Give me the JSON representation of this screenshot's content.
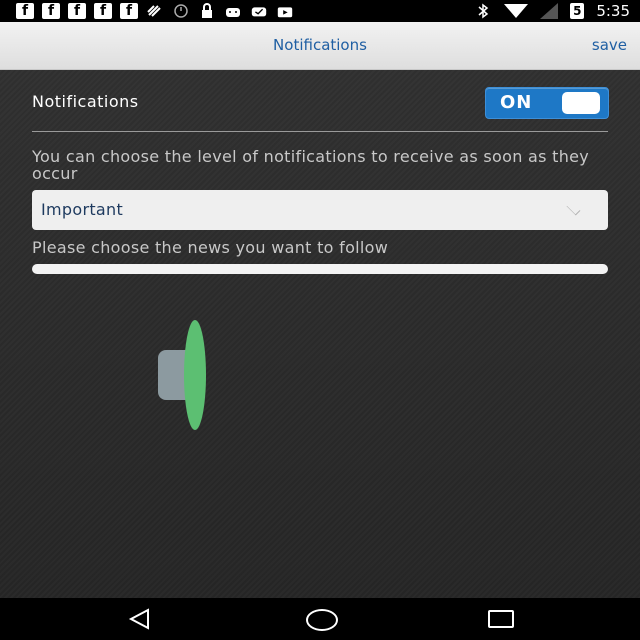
{
  "status_bar": {
    "time": "5:35",
    "battery_glyph": "5",
    "facebook_glyph": "f",
    "notification_icons": [
      "facebook-icon",
      "facebook-icon",
      "facebook-icon",
      "facebook-icon",
      "facebook-icon",
      "satellite-icon",
      "clock-icon",
      "lock-icon",
      "android-icon",
      "cloud-check-icon",
      "play-store-icon"
    ],
    "system_icons": [
      "bluetooth-icon",
      "wifi-icon",
      "signal-icon",
      "battery-icon"
    ]
  },
  "topbar": {
    "title": "Notifications",
    "save_label": "save"
  },
  "settings": {
    "notifications_label": "Notifications",
    "toggle_label": "ON",
    "toggle_state": true,
    "description": "You can choose the level of notifications to receive as soon as they occur",
    "level_selected": "Important",
    "news_prompt": "Please choose the news you want to follow"
  },
  "colors": {
    "accent": "#1e78c6",
    "title_blue": "#1f5fa3",
    "spinner_green": "#5cbf72"
  },
  "navbar": {
    "icons": [
      "back-icon",
      "home-icon",
      "recent-apps-icon"
    ]
  }
}
